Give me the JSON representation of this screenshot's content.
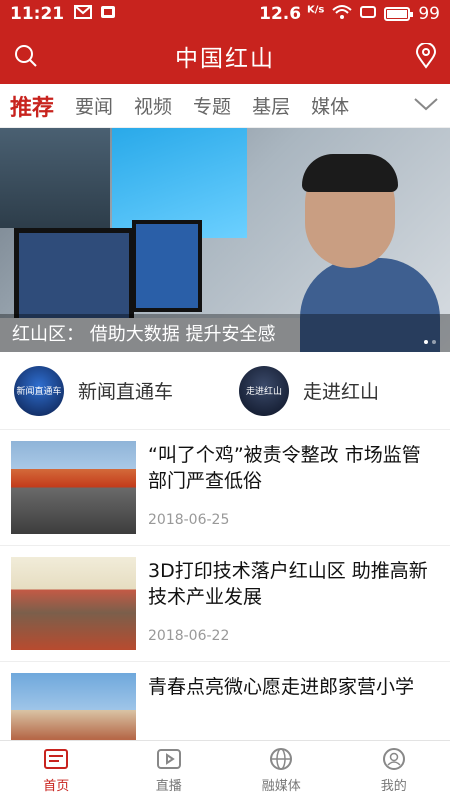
{
  "status_bar": {
    "time": "11:21",
    "speed_value": "12.6",
    "speed_unit": "K/s",
    "battery": "99",
    "battery_level": 0.99
  },
  "header": {
    "title": "中国红山"
  },
  "tabs": [
    {
      "label": "推荐"
    },
    {
      "label": "要闻"
    },
    {
      "label": "视频"
    },
    {
      "label": "专题"
    },
    {
      "label": "基层"
    },
    {
      "label": "媒体"
    }
  ],
  "hero": {
    "caption": "红山区：  借助大数据 提升安全感",
    "slides": 2,
    "active_slide": 1
  },
  "channels": [
    {
      "name": "新闻直通车",
      "logo_text": "新闻直通车"
    },
    {
      "name": "走进红山",
      "logo_text": "走进红山"
    }
  ],
  "news": [
    {
      "headline": "“叫了个鸡”被责令整改  市场监管部门严查低俗",
      "date": "2018-06-25"
    },
    {
      "headline": "3D打印技术落户红山区 助推高新技术产业发展",
      "date": "2018-06-22"
    },
    {
      "headline": "青春点亮微心愿走进郎家营小学",
      "date": ""
    }
  ],
  "bottom_nav": [
    {
      "label": "首页",
      "icon": "news-icon"
    },
    {
      "label": "直播",
      "icon": "play-icon"
    },
    {
      "label": "融媒体",
      "icon": "globe-icon"
    },
    {
      "label": "我的",
      "icon": "user-icon"
    }
  ],
  "colors": {
    "brand": "#c8231e",
    "text": "#222222",
    "muted": "#999999"
  }
}
